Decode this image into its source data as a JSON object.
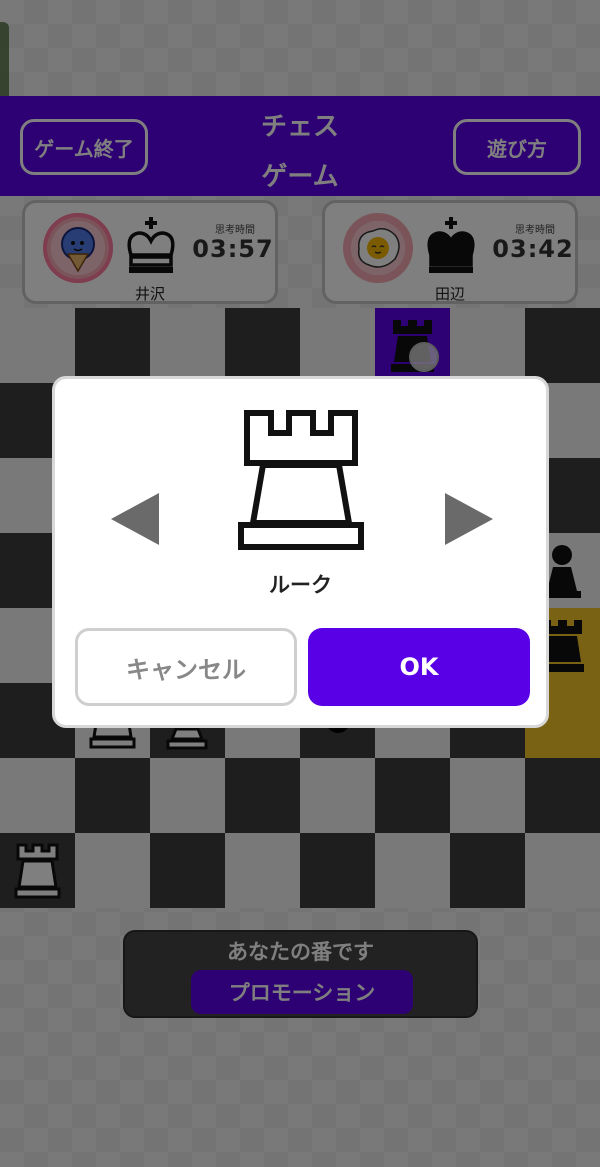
{
  "header": {
    "title_line1": "チェス",
    "title_line2": "ゲーム",
    "end_game_label": "ゲーム終了",
    "how_to_play_label": "遊び方"
  },
  "players": [
    {
      "name": "井沢",
      "time_label": "思考時間",
      "time": "03:57",
      "avatar": "blue-ice-cream-avatar",
      "piece_color": "white"
    },
    {
      "name": "田辺",
      "time_label": "思考時間",
      "time": "03:42",
      "avatar": "fried-egg-avatar",
      "piece_color": "black"
    }
  ],
  "status": {
    "turn_text": "あなたの番です",
    "phase_label": "プロモーション"
  },
  "promotion_dialog": {
    "selected_piece_name": "ルーク",
    "selected_piece_icon": "white-rook-icon",
    "prev_icon": "triangle-left-icon",
    "next_icon": "triangle-right-icon",
    "cancel_label": "キャンセル",
    "ok_label": "OK"
  },
  "colors": {
    "accent": "#5a00e6",
    "last_move_highlight": "#f3c428",
    "dark_square": "#3d3d3d",
    "light_square": "#f2f2f2"
  }
}
